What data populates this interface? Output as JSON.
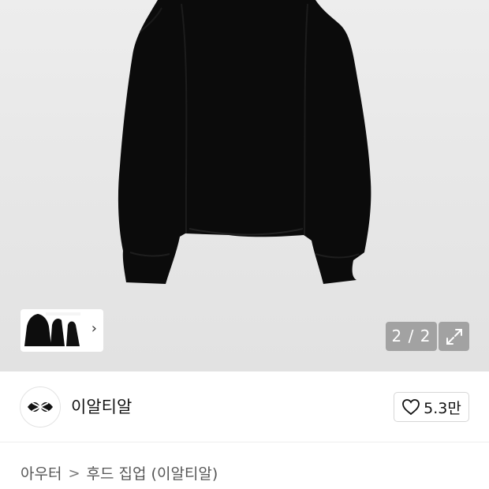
{
  "gallery": {
    "counter": "2 / 2",
    "thumbnail_more_icon": "chevron-right-icon",
    "expand_icon": "expand-icon"
  },
  "seller": {
    "name": "이알티알",
    "logo_icon": "brand-logo-icon"
  },
  "like": {
    "icon": "heart-outline-icon",
    "count": "5.3만"
  },
  "breadcrumb": {
    "items": [
      "아우터",
      "후드 집업 (이알티알)"
    ]
  }
}
